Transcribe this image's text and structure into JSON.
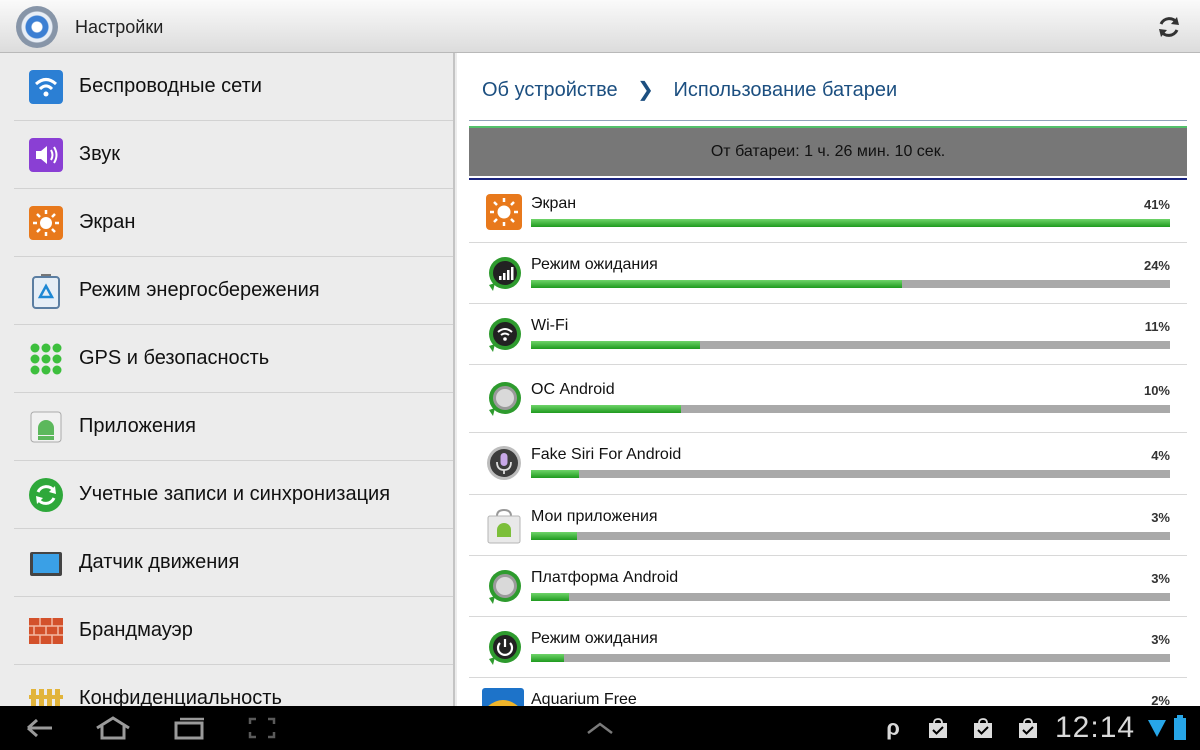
{
  "app": {
    "title": "Настройки"
  },
  "sidebar": {
    "items": [
      {
        "label": "Беспроводные сети",
        "icon": "wifi-icon"
      },
      {
        "label": "Звук",
        "icon": "speaker-icon"
      },
      {
        "label": "Экран",
        "icon": "brightness-icon"
      },
      {
        "label": "Режим энергосбережения",
        "icon": "battery-saver-icon"
      },
      {
        "label": "GPS и безопасность",
        "icon": "gps-grid-icon"
      },
      {
        "label": "Приложения",
        "icon": "android-box-icon"
      },
      {
        "label": "Учетные записи и синхронизация",
        "icon": "sync-icon"
      },
      {
        "label": "Датчик движения",
        "icon": "tablet-motion-icon"
      },
      {
        "label": "Брандмауэр",
        "icon": "firewall-icon"
      },
      {
        "label": "Конфиденциальность",
        "icon": "fence-icon"
      }
    ]
  },
  "breadcrumb": {
    "parent": "Об устройстве",
    "current": "Использование батареи"
  },
  "battery": {
    "summary": "От батареи: 1 ч. 26 мин. 10 сек.",
    "items": [
      {
        "name": "Экран",
        "percent": "41%",
        "fill": 1.0,
        "icon": "brightness-icon"
      },
      {
        "name": "Режим ожидания",
        "percent": "24%",
        "fill": 0.58,
        "icon": "signal-icon"
      },
      {
        "name": "Wi-Fi",
        "percent": "11%",
        "fill": 0.265,
        "icon": "wifi-dark-icon"
      },
      {
        "name": "ОС Android",
        "percent": "10%",
        "fill": 0.235,
        "icon": "android-os-icon"
      },
      {
        "name": "Fake Siri For Android",
        "percent": "4%",
        "fill": 0.075,
        "icon": "microphone-icon"
      },
      {
        "name": "Мои приложения",
        "percent": "3%",
        "fill": 0.072,
        "icon": "app-bag-icon"
      },
      {
        "name": "Платформа Android",
        "percent": "3%",
        "fill": 0.06,
        "icon": "android-os-icon"
      },
      {
        "name": "Режим ожидания",
        "percent": "3%",
        "fill": 0.052,
        "icon": "power-icon"
      },
      {
        "name": "Aquarium Free",
        "percent": "2%",
        "fill": 0.04,
        "icon": "aquarium-icon"
      }
    ]
  },
  "system_bar": {
    "time": "12:14",
    "buttons": [
      "back-icon",
      "home-icon",
      "recent-apps-icon",
      "screenshot-icon",
      "chevron-up-icon"
    ],
    "status_icons": [
      "p-notification-icon",
      "shop-bag-icon",
      "shop-bag-icon",
      "shop-bag-icon",
      "wifi-status-icon",
      "battery-status-icon"
    ]
  }
}
